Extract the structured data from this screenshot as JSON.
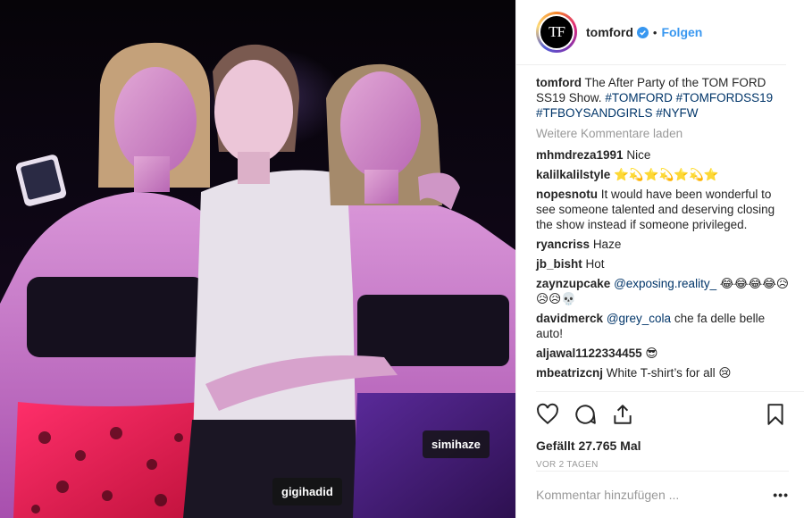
{
  "post": {
    "tags": {
      "left": "gigihadid",
      "right": "simihaze"
    },
    "colors": {
      "accent": "#3897f0",
      "hashtag": "#003569",
      "muted": "#999999"
    }
  },
  "header": {
    "avatar_text": "TF",
    "username": "tomford",
    "dot": "•",
    "follow_label": "Folgen"
  },
  "caption": {
    "username": "tomford",
    "text": " The After Party of the TOM FORD SS19 Show. ",
    "hashtags": [
      "#TOMFORD",
      "#TOMFORDSS19",
      "#TFBOYSANDGIRLS",
      "#NYFW"
    ]
  },
  "load_more": "Weitere Kommentare laden",
  "comments": [
    {
      "user": "mhmdreza1991",
      "text": "Nice"
    },
    {
      "user": "kalilkalilstyle",
      "text": "⭐️💫⭐️💫⭐️💫⭐️"
    },
    {
      "user": "nopesnotu",
      "text": "It would have been wonderful to see someone talented and deserving closing the show instead if someone privileged."
    },
    {
      "user": "ryancriss",
      "text": "Haze"
    },
    {
      "user": "jb_bisht",
      "text": "Hot"
    },
    {
      "user": "zaynzupcake",
      "mention": "@exposing.reality_",
      "text": " 😂😂😂😂😥😥😥💀"
    },
    {
      "user": "davidmerck",
      "mention": "@grey_cola",
      "text": " che fa delle belle auto!"
    },
    {
      "user": "aljawal1122334455",
      "text": "😎"
    },
    {
      "user": "mbeatrizcnj",
      "text": "White T-shirt’s for all 😢"
    }
  ],
  "actions": {
    "likes": "Gefällt 27.765 Mal",
    "time": "VOR 2 TAGEN",
    "add_comment_placeholder": "Kommentar hinzufügen ...",
    "more": "•••"
  },
  "icons": [
    "heart-icon",
    "comment-icon",
    "share-icon",
    "bookmark-icon",
    "verified-icon"
  ]
}
